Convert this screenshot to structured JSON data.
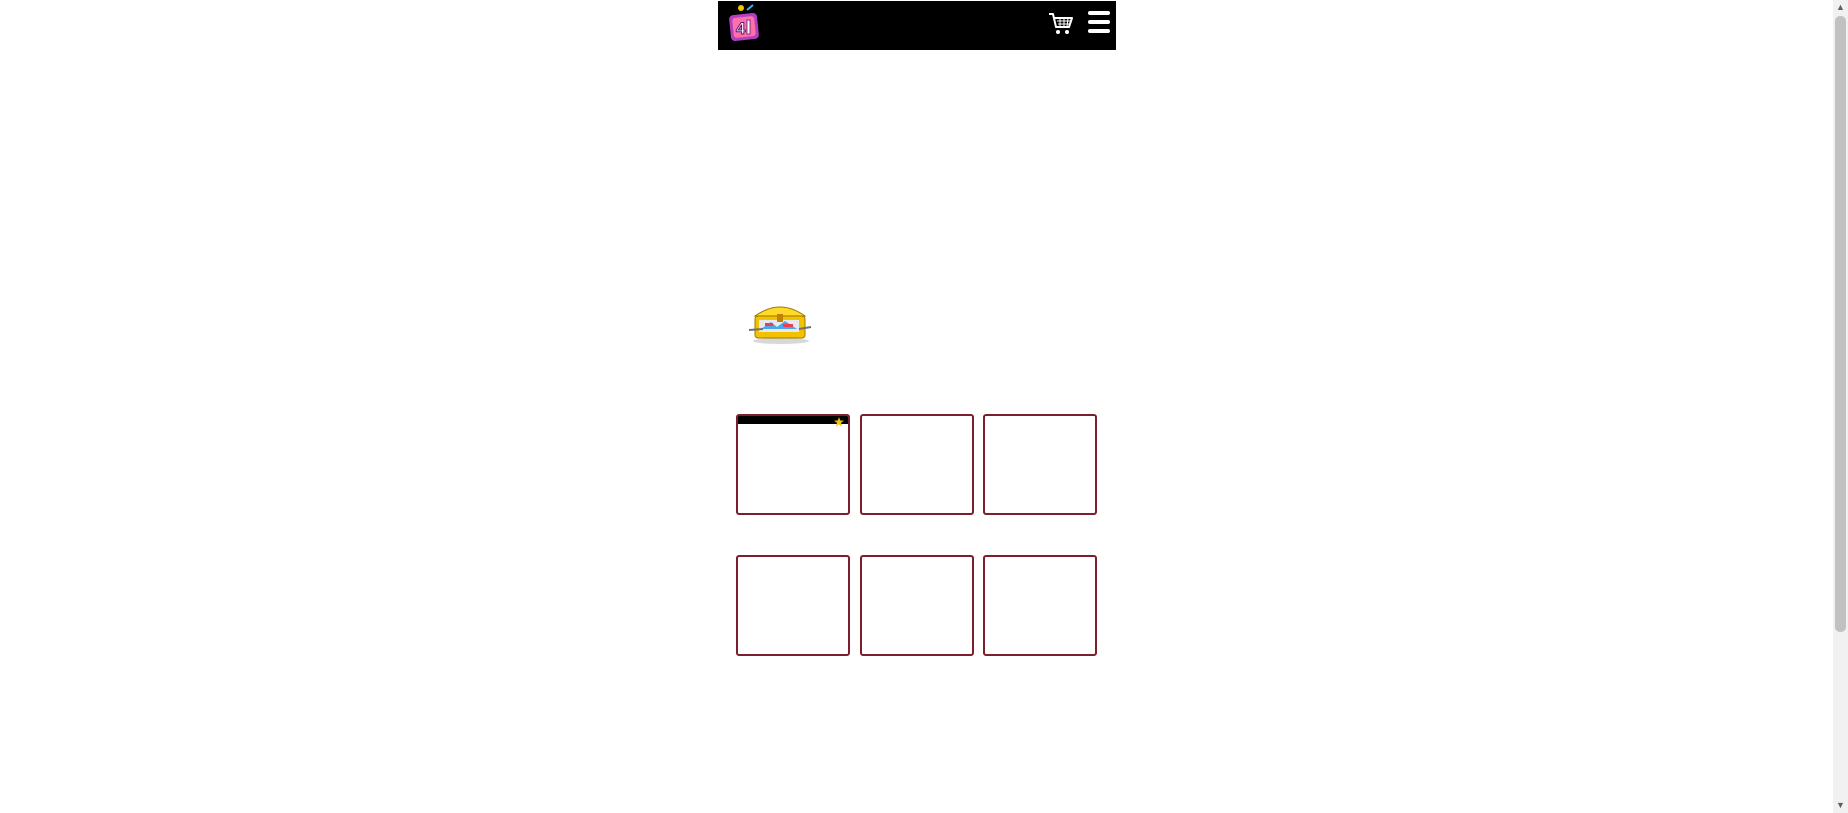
{
  "header": {
    "logo_icon": "brand-logo",
    "cart_icon": "shopping-cart-icon",
    "menu_icon": "hamburger-menu-icon",
    "background": "#000000"
  },
  "main": {
    "featured_image": "treasure-chest-image",
    "tiles": [
      {
        "icon": "product-tile"
      },
      {
        "icon": "product-tile"
      },
      {
        "icon": "product-tile"
      },
      {
        "icon": "product-tile"
      },
      {
        "icon": "product-tile"
      },
      {
        "icon": "product-tile"
      }
    ],
    "tile_border_color": "#7a1f2b"
  },
  "scrollbar": {
    "up_arrow": "▲",
    "down_arrow": "▼"
  }
}
